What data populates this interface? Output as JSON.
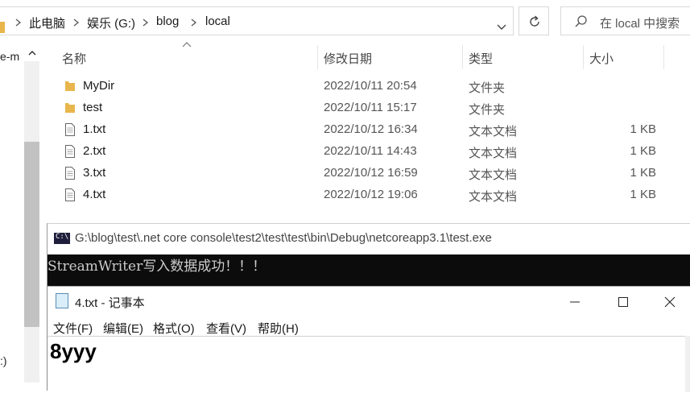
{
  "address": {
    "crumbs": [
      "此电脑",
      "娱乐 (G:)",
      "blog",
      "local"
    ],
    "search_placeholder": "在 local 中搜索"
  },
  "nav": {
    "item_top": "e-m",
    "item_bottom": ":)"
  },
  "columns": {
    "name": "名称",
    "date": "修改日期",
    "type": "类型",
    "size": "大小"
  },
  "files": [
    {
      "name": "MyDir",
      "date": "2022/10/11 20:54",
      "type": "文件夹",
      "size": "",
      "icon": "folder-icon"
    },
    {
      "name": "test",
      "date": "2022/10/11 15:17",
      "type": "文件夹",
      "size": "",
      "icon": "folder-icon"
    },
    {
      "name": "1.txt",
      "date": "2022/10/12 16:34",
      "type": "文本文档",
      "size": "1 KB",
      "icon": "text-file-icon"
    },
    {
      "name": "2.txt",
      "date": "2022/10/11 14:43",
      "type": "文本文档",
      "size": "1 KB",
      "icon": "text-file-icon"
    },
    {
      "name": "3.txt",
      "date": "2022/10/12 16:59",
      "type": "文本文档",
      "size": "1 KB",
      "icon": "text-file-icon"
    },
    {
      "name": "4.txt",
      "date": "2022/10/12 19:06",
      "type": "文本文档",
      "size": "1 KB",
      "icon": "text-file-icon"
    }
  ],
  "console": {
    "icon_text": "C:\\",
    "title": "G:\\blog\\test\\.net core console\\test2\\test\\test\\bin\\Debug\\netcoreapp3.1\\test.exe",
    "output": "StreamWriter写入数据成功！！！"
  },
  "notepad": {
    "title": "4.txt - 记事本",
    "menus": [
      "文件(F)",
      "编辑(E)",
      "格式(O)",
      "查看(V)",
      "帮助(H)"
    ],
    "content": "8yyy"
  },
  "colors": {
    "folder": "#e8b64c",
    "console_bg": "#0c0c0c",
    "console_fg": "#cccccc"
  }
}
